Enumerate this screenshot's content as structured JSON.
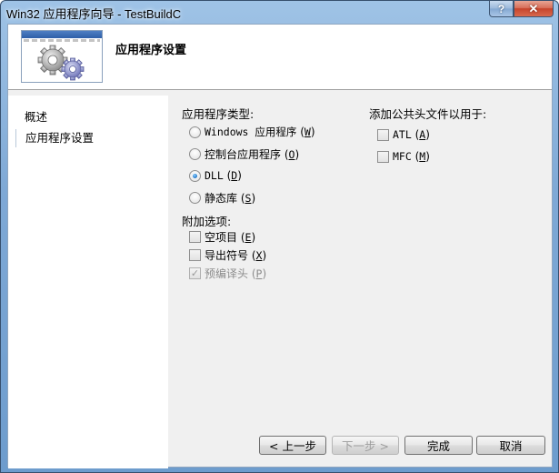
{
  "window": {
    "title": "Win32 应用程序向导 - TestBuildC",
    "help_button": "?",
    "close_button": "✕"
  },
  "header": {
    "title": "应用程序设置",
    "banner_icon": "gears-icon"
  },
  "nav": {
    "items": [
      {
        "label": "概述",
        "selected": false
      },
      {
        "label": "应用程序设置",
        "selected": true
      }
    ]
  },
  "app_type": {
    "label": "应用程序类型:",
    "options": [
      {
        "text": "Windows 应用程序",
        "key": "W",
        "checked": false
      },
      {
        "text": "控制台应用程序",
        "key": "O",
        "checked": false
      },
      {
        "text": "DLL",
        "key": "D",
        "checked": true
      },
      {
        "text": "静态库",
        "key": "S",
        "checked": false
      }
    ]
  },
  "extra": {
    "label": "附加选项:",
    "options": [
      {
        "text": "空项目",
        "key": "E",
        "checked": false,
        "enabled": true
      },
      {
        "text": "导出符号",
        "key": "X",
        "checked": false,
        "enabled": true
      },
      {
        "text": "预编译头",
        "key": "P",
        "checked": true,
        "enabled": false
      }
    ]
  },
  "headers": {
    "label": "添加公共头文件以用于:",
    "options": [
      {
        "text": "ATL",
        "key": "A",
        "checked": false
      },
      {
        "text": "MFC",
        "key": "M",
        "checked": false
      }
    ]
  },
  "buttons": {
    "prev": "< 上一步",
    "next": "下一步 >",
    "finish": "完成",
    "cancel": "取消"
  },
  "colors": {
    "accent": "#2a7fd0",
    "close": "#c7442c"
  }
}
